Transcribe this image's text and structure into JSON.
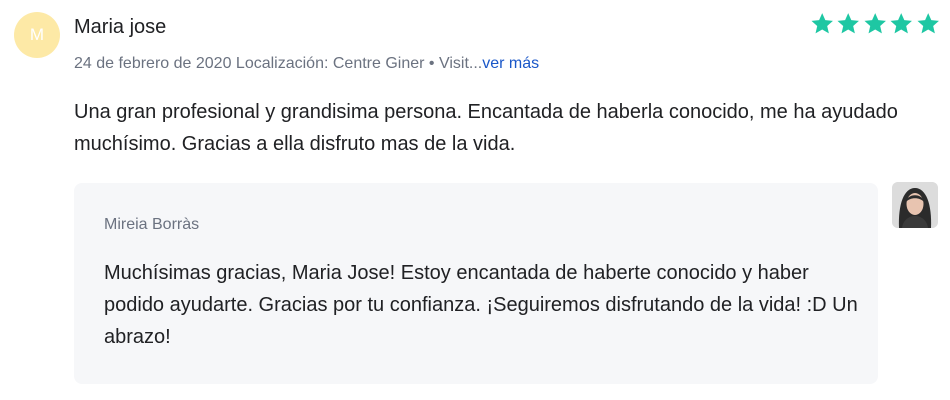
{
  "review": {
    "avatar_initial": "M",
    "author": "Maria jose",
    "rating": 5,
    "rating_color": "#1ec7a3",
    "date": "24 de febrero de 2020",
    "location": "Localización: Centre Giner • Visit...",
    "more_label": "ver más",
    "text": "Una gran profesional y grandisima persona. Encantada de haberla conocido, me ha ayudado muchísimo. Gracias a ella disfruto mas de la vida."
  },
  "reply": {
    "author": "Mireia Borràs",
    "avatar_icon": "profile-photo",
    "text": "Muchísimas gracias, Maria Jose! Estoy encantada de haberte conocido y haber podido ayudarte. Gracias por tu confianza. ¡Seguiremos disfrutando de la vida! :D Un abrazo!"
  }
}
